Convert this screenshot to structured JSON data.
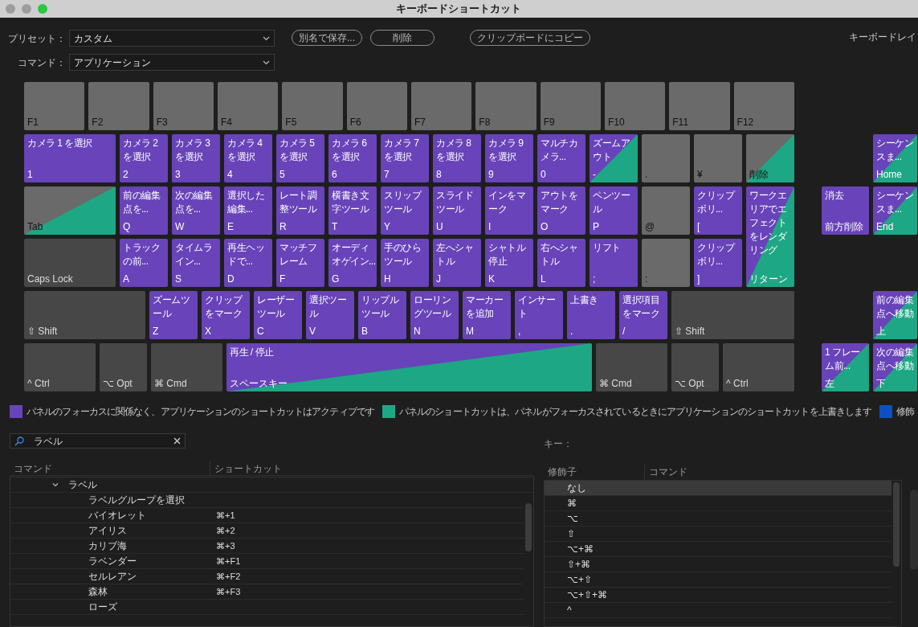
{
  "window": {
    "title": "キーボードショートカット"
  },
  "toolbar": {
    "preset": {
      "label": "プリセット：",
      "value": "カスタム"
    },
    "command": {
      "label": "コマンド：",
      "value": "アプリケーション"
    },
    "buttons": [
      "別名で保存...",
      "削除",
      "クリップボードにコピー"
    ],
    "layout_label": "キーボードレイ"
  },
  "keyboard": {
    "function_row": [
      {
        "key": "F1",
        "kind": "empty",
        "panel": false
      },
      {
        "key": "F2",
        "kind": "empty",
        "panel": false
      },
      {
        "key": "F3",
        "kind": "empty",
        "panel": false
      },
      {
        "key": "F4",
        "kind": "empty",
        "panel": false
      },
      {
        "key": "F5",
        "kind": "empty",
        "panel": false
      },
      {
        "key": "F6",
        "kind": "empty",
        "panel": false
      },
      {
        "key": "F7",
        "kind": "empty",
        "panel": false
      },
      {
        "key": "F8",
        "kind": "empty",
        "panel": false
      },
      {
        "key": "F9",
        "kind": "empty",
        "panel": false
      },
      {
        "key": "F10",
        "kind": "empty",
        "panel": false
      },
      {
        "key": "F11",
        "kind": "empty",
        "panel": false
      },
      {
        "key": "F12",
        "kind": "empty",
        "panel": false
      }
    ],
    "number_row": [
      {
        "key": "1",
        "command": [
          "カメラ 1 を選択"
        ],
        "kind": "app",
        "panel": false
      },
      {
        "key": "2",
        "command": [
          "カメラ 2",
          "を選択"
        ],
        "kind": "app",
        "panel": false
      },
      {
        "key": "3",
        "command": [
          "カメラ 3",
          "を選択"
        ],
        "kind": "app",
        "panel": false
      },
      {
        "key": "4",
        "command": [
          "カメラ 4",
          "を選択"
        ],
        "kind": "app",
        "panel": false
      },
      {
        "key": "5",
        "command": [
          "カメラ 5",
          "を選択"
        ],
        "kind": "app",
        "panel": false
      },
      {
        "key": "6",
        "command": [
          "カメラ 6",
          "を選択"
        ],
        "kind": "app",
        "panel": false
      },
      {
        "key": "7",
        "command": [
          "カメラ 7",
          "を選択"
        ],
        "kind": "app",
        "panel": false
      },
      {
        "key": "8",
        "command": [
          "カメラ 8",
          "を選択"
        ],
        "kind": "app",
        "panel": false
      },
      {
        "key": "9",
        "command": [
          "カメラ 9",
          "を選択"
        ],
        "kind": "app",
        "panel": false
      },
      {
        "key": "0",
        "command": [
          "マルチカ",
          "メラ..."
        ],
        "kind": "app",
        "panel": false
      },
      {
        "key": "-",
        "command": [
          "ズームア",
          "ウト"
        ],
        "kind": "app",
        "panel": true
      },
      {
        "key": ".",
        "kind": "empty",
        "panel": false
      },
      {
        "key": "¥",
        "kind": "empty",
        "panel": false
      },
      {
        "key": "削除",
        "kind": "empty",
        "panel": true
      }
    ],
    "top_row": [
      {
        "key": "Tab",
        "kind": "empty",
        "panel": true
      },
      {
        "key": "Q",
        "command": [
          "前の編集",
          "点を..."
        ],
        "kind": "app",
        "panel": false
      },
      {
        "key": "W",
        "command": [
          "次の編集",
          "点を..."
        ],
        "kind": "app",
        "panel": false
      },
      {
        "key": "E",
        "command": [
          "選択した",
          "編集..."
        ],
        "kind": "app",
        "panel": false
      },
      {
        "key": "R",
        "command": [
          "レート調",
          "整ツール"
        ],
        "kind": "app",
        "panel": false
      },
      {
        "key": "T",
        "command": [
          "横書き文",
          "字ツール"
        ],
        "kind": "app",
        "panel": false
      },
      {
        "key": "Y",
        "command": [
          "スリップ",
          "ツール"
        ],
        "kind": "app",
        "panel": false
      },
      {
        "key": "U",
        "command": [
          "スライド",
          "ツール"
        ],
        "kind": "app",
        "panel": false
      },
      {
        "key": "I",
        "command": [
          "インをマ",
          "ーク"
        ],
        "kind": "app",
        "panel": false
      },
      {
        "key": "O",
        "command": [
          "アウトを",
          "マーク"
        ],
        "kind": "app",
        "panel": false
      },
      {
        "key": "P",
        "command": [
          "ペンツー",
          "ル"
        ],
        "kind": "app",
        "panel": false
      },
      {
        "key": "@",
        "kind": "empty",
        "panel": false
      },
      {
        "key": "[",
        "command": [
          "クリップ",
          "ボリ..."
        ],
        "kind": "app",
        "panel": false
      }
    ],
    "home_row": [
      {
        "key": "Caps Lock",
        "kind": "modifier",
        "panel": false
      },
      {
        "key": "A",
        "command": [
          "トラック",
          "の前..."
        ],
        "kind": "app",
        "panel": false
      },
      {
        "key": "S",
        "command": [
          "タイムラ",
          "イン..."
        ],
        "kind": "app",
        "panel": false
      },
      {
        "key": "D",
        "command": [
          "再生ヘッ",
          "ドで..."
        ],
        "kind": "app",
        "panel": false
      },
      {
        "key": "F",
        "command": [
          "マッチフ",
          "レーム"
        ],
        "kind": "app",
        "panel": false
      },
      {
        "key": "G",
        "command": [
          "オーディ",
          "オゲイン..."
        ],
        "kind": "app",
        "panel": false
      },
      {
        "key": "H",
        "command": [
          "手のひら",
          "ツール"
        ],
        "kind": "app",
        "panel": false
      },
      {
        "key": "J",
        "command": [
          "左へシャ",
          "トル"
        ],
        "kind": "app",
        "panel": false
      },
      {
        "key": "K",
        "command": [
          "シャトル",
          "停止"
        ],
        "kind": "app",
        "panel": false
      },
      {
        "key": "L",
        "command": [
          "右へシャ",
          "トル"
        ],
        "kind": "app",
        "panel": false
      },
      {
        "key": ";",
        "command": [
          "リフト"
        ],
        "kind": "app",
        "panel": false
      },
      {
        "key": ":",
        "kind": "empty",
        "panel": false
      },
      {
        "key": "]",
        "command": [
          "クリップ",
          "ボリ..."
        ],
        "kind": "app",
        "panel": false
      }
    ],
    "return_key": {
      "key": "リターン",
      "command": [
        "ワークエ",
        "リアでエ",
        "フェクト",
        "をレンダ",
        "リング"
      ],
      "kind": "app",
      "panel": true
    },
    "shift_row": [
      {
        "key": "⇧ Shift",
        "kind": "modifier",
        "panel": false
      },
      {
        "key": "Z",
        "command": [
          "ズームツ",
          "ール"
        ],
        "kind": "app",
        "panel": false
      },
      {
        "key": "X",
        "command": [
          "クリップ",
          "をマーク"
        ],
        "kind": "app",
        "panel": false
      },
      {
        "key": "C",
        "command": [
          "レーザー",
          "ツール"
        ],
        "kind": "app",
        "panel": false
      },
      {
        "key": "V",
        "command": [
          "選択ツー",
          "ル"
        ],
        "kind": "app",
        "panel": false
      },
      {
        "key": "B",
        "command": [
          "リップル",
          "ツール"
        ],
        "kind": "app",
        "panel": false
      },
      {
        "key": "N",
        "command": [
          "ローリン",
          "グツール"
        ],
        "kind": "app",
        "panel": false
      },
      {
        "key": "M",
        "command": [
          "マーカー",
          "を追加"
        ],
        "kind": "app",
        "panel": false
      },
      {
        "key": ",",
        "command": [
          "インサー",
          "ト"
        ],
        "kind": "app",
        "panel": false
      },
      {
        "key": ".",
        "command": [
          "上書き"
        ],
        "kind": "app",
        "panel": false
      },
      {
        "key": "/",
        "command": [
          "選択項目",
          "をマーク"
        ],
        "kind": "app",
        "panel": false
      },
      {
        "key": "⇧ Shift",
        "kind": "modifier",
        "panel": false
      }
    ],
    "bottom_row": [
      {
        "key": "^ Ctrl",
        "kind": "modifier",
        "panel": false
      },
      {
        "key": "⌥ Opt",
        "kind": "modifier",
        "panel": false
      },
      {
        "key": "⌘ Cmd",
        "kind": "modifier",
        "panel": false
      },
      {
        "key": "スペースキー",
        "command": [
          "再生 / 停止"
        ],
        "kind": "app",
        "panel": true
      },
      {
        "key": "⌘ Cmd",
        "kind": "modifier",
        "panel": false
      },
      {
        "key": "⌥ Opt",
        "kind": "modifier",
        "panel": false
      },
      {
        "key": "^ Ctrl",
        "kind": "modifier",
        "panel": false
      }
    ],
    "nav_cluster": [
      {
        "key": "Home",
        "command": [
          "シーケン",
          "スま..."
        ],
        "kind": "app",
        "panel": true
      },
      {
        "key": "前方削除",
        "command": [
          "消去"
        ],
        "kind": "app",
        "panel": false
      },
      {
        "key": "End",
        "command": [
          "シーケン",
          "スま..."
        ],
        "kind": "app",
        "panel": true
      },
      {
        "key": "上",
        "command": [
          "前の編集",
          "点へ移動"
        ],
        "kind": "app",
        "panel": true
      },
      {
        "key": "左",
        "command": [
          "1 フレー",
          "ム前..."
        ],
        "kind": "app",
        "panel": true
      },
      {
        "key": "下",
        "command": [
          "次の編集",
          "点へ移動"
        ],
        "kind": "app",
        "panel": true
      }
    ]
  },
  "legend": [
    {
      "text": "パネルのフォーカスに関係なく、アプリケーションのショートカットはアクティブです",
      "color": "#6843b9"
    },
    {
      "text": "パネルのショートカットは、パネルがフォーカスされているときにアプリケーションのショートカットを上書きします",
      "color": "#1ea784"
    },
    {
      "text": "修飾",
      "color": "#0d4fc4"
    }
  ],
  "search": {
    "value": "ラベル"
  },
  "command_table": {
    "columns": [
      "コマンド",
      "ショートカット"
    ],
    "rows": [
      {
        "label": "ラベル",
        "expanded": true,
        "children": [
          {
            "label": "ラベルグループを選択"
          },
          {
            "label": "バイオレット",
            "shortcut": "⌘+1"
          },
          {
            "label": "アイリス",
            "shortcut": "⌘+2"
          },
          {
            "label": "カリブ海",
            "shortcut": "⌘+3"
          },
          {
            "label": "ラベンダー",
            "shortcut": "⌘+F1"
          },
          {
            "label": "セルレアン",
            "shortcut": "⌘+F2"
          },
          {
            "label": "森林",
            "shortcut": "⌘+F3"
          },
          {
            "label": "ローズ"
          }
        ]
      }
    ]
  },
  "key_panel": {
    "label": "キー：",
    "columns": [
      "修飾子",
      "コマンド"
    ],
    "rows": [
      {
        "modifier": "なし",
        "selected": true
      },
      {
        "modifier": "⌘",
        "selected": false
      },
      {
        "modifier": "⌥",
        "selected": false
      },
      {
        "modifier": "⇧",
        "selected": false
      },
      {
        "modifier": "⌥+⌘",
        "selected": false
      },
      {
        "modifier": "⇧+⌘",
        "selected": false
      },
      {
        "modifier": "⌥+⇧",
        "selected": false
      },
      {
        "modifier": "⌥+⇧+⌘",
        "selected": false
      },
      {
        "modifier": "^",
        "selected": false
      }
    ]
  }
}
